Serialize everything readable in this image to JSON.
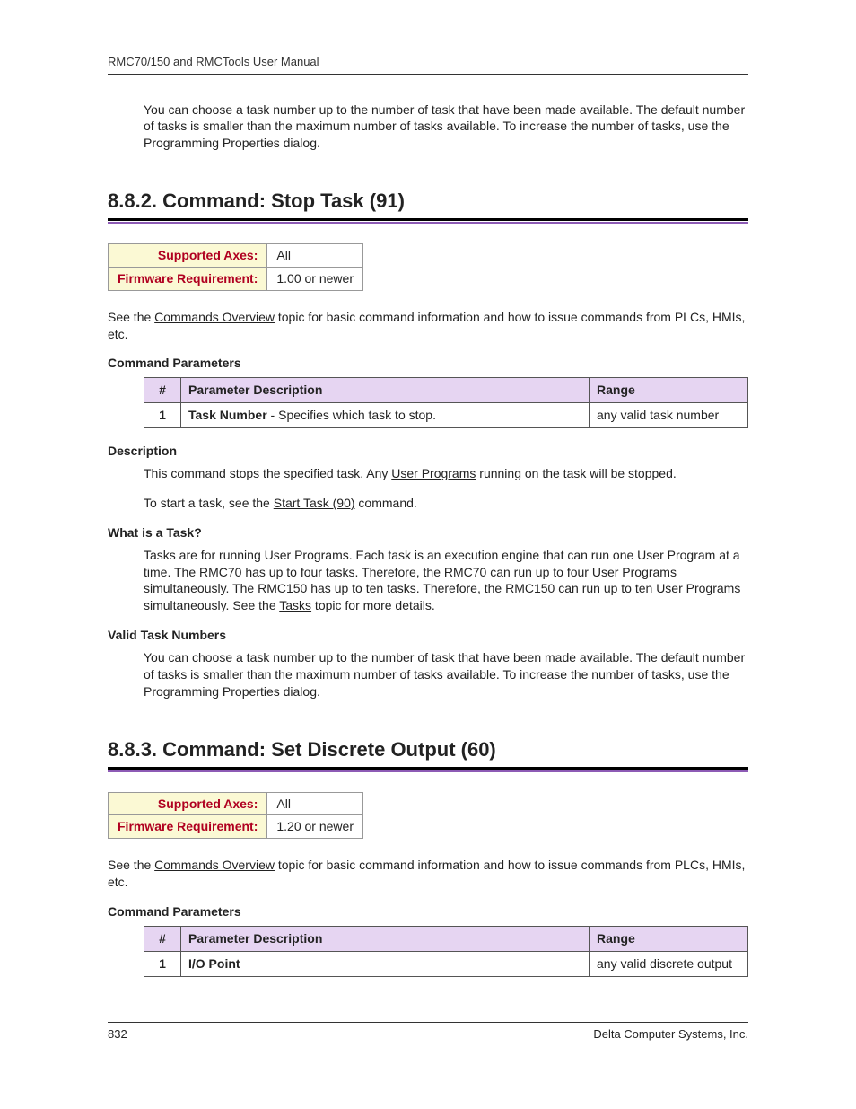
{
  "header": "RMC70/150 and RMCTools User Manual",
  "intro_para": "You can choose a task number up to the number of task that have been made available. The default number of tasks is smaller than the maximum number of tasks available. To increase the number of tasks, use the Programming Properties dialog.",
  "sec1": {
    "heading": "8.8.2. Command: Stop Task (91)",
    "info": {
      "row1_label": "Supported Axes:",
      "row1_value": "All",
      "row2_label": "Firmware Requirement:",
      "row2_value": "1.00 or newer"
    },
    "see_pre": "See the ",
    "see_link": "Commands Overview",
    "see_post": " topic for basic command information and how to issue commands from PLCs, HMIs, etc.",
    "params_heading": "Command Parameters",
    "params_table": {
      "h1": "#",
      "h2": "Parameter Description",
      "h3": "Range",
      "r1c1": "1",
      "r1c2a": "Task Number",
      "r1c2b": " - Specifies which task to stop.",
      "r1c3": "any valid task number"
    },
    "desc_heading": "Description",
    "desc_p1a": "This command stops the specified task. Any ",
    "desc_p1_link": "User Programs",
    "desc_p1b": " running on the task will be stopped.",
    "desc_p2a": "To start a task, see the ",
    "desc_p2_link": "Start Task (90)",
    "desc_p2b": " command.",
    "what_heading": "What is a Task?",
    "what_pa": "Tasks are for running User Programs. Each task is an execution engine that can run one User Program at a time. The RMC70 has up to four tasks. Therefore, the RMC70 can run up to four User Programs simultaneously. The RMC150 has up to ten tasks. Therefore, the RMC150 can run up to ten User Programs simultaneously. See the ",
    "what_link": "Tasks",
    "what_pb": " topic for more details.",
    "valid_heading": "Valid Task Numbers",
    "valid_p": "You can choose a task number up to the number of task that have been made available. The default number of tasks is smaller than the maximum number of tasks available. To increase the number of tasks, use the Programming Properties dialog."
  },
  "sec2": {
    "heading": "8.8.3. Command: Set Discrete Output (60)",
    "info": {
      "row1_label": "Supported Axes:",
      "row1_value": "All",
      "row2_label": "Firmware Requirement:",
      "row2_value": "1.20 or newer"
    },
    "see_pre": "See the ",
    "see_link": "Commands Overview",
    "see_post": " topic for basic command information and how to issue commands from PLCs, HMIs, etc.",
    "params_heading": "Command Parameters",
    "params_table": {
      "h1": "#",
      "h2": "Parameter Description",
      "h3": "Range",
      "r1c1": "1",
      "r1c2": "I/O Point",
      "r1c3": "any valid discrete output"
    }
  },
  "footer": {
    "page": "832",
    "company": "Delta Computer Systems, Inc."
  }
}
